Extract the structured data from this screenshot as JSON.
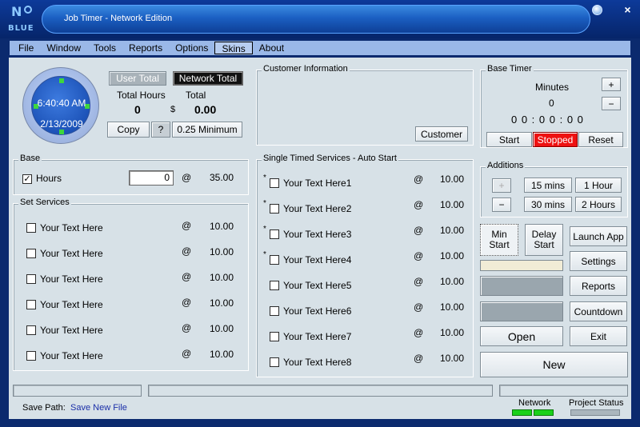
{
  "window": {
    "title": "Job Timer - Network Edition",
    "logo_letter": "N",
    "logo_text": "BLUE",
    "close_glyph": "×"
  },
  "menu": [
    "File",
    "Window",
    "Tools",
    "Reports",
    "Options",
    "Skins",
    "About"
  ],
  "menu_active": "Skins",
  "clock": {
    "time": "6:40:40 AM",
    "date": "2/13/2009"
  },
  "totals": {
    "user_total_label": "User Total",
    "network_total_label": "Network Total",
    "total_hours_label": "Total Hours",
    "total_label": "Total",
    "hours_value": "0",
    "currency": "$",
    "amount": "0.00",
    "copy_label": "Copy",
    "help_label": "?",
    "minimum_label": "0.25 Minimum"
  },
  "customer": {
    "group_label": "Customer Information",
    "button": "Customer"
  },
  "base_timer": {
    "group_label": "Base Timer",
    "minutes_label": "Minutes",
    "minutes_value": "0",
    "plus": "+",
    "minus": "−",
    "display": "0 0 : 0 0 : 0 0",
    "start": "Start",
    "stopped": "Stopped",
    "reset": "Reset"
  },
  "additions": {
    "group_label": "Additions",
    "plus": "+",
    "minus": "−",
    "buttons": [
      "15 mins",
      "1 Hour",
      "30 mins",
      "2 Hours"
    ]
  },
  "base": {
    "group_label": "Base",
    "label": "Hours",
    "checked": "✓",
    "input_value": "0",
    "at": "@",
    "rate": "35.00"
  },
  "set_services": {
    "group_label": "Set Services",
    "at": "@",
    "items": [
      {
        "label": "Your Text Here",
        "rate": "10.00"
      },
      {
        "label": "Your Text Here",
        "rate": "10.00"
      },
      {
        "label": "Your Text Here",
        "rate": "10.00"
      },
      {
        "label": "Your Text Here",
        "rate": "10.00"
      },
      {
        "label": "Your Text Here",
        "rate": "10.00"
      },
      {
        "label": "Your Text Here",
        "rate": "10.00"
      }
    ]
  },
  "timed_services": {
    "group_label": "Single Timed Services - Auto Start",
    "at": "@",
    "star": "*",
    "items": [
      {
        "label": "Your Text Here1",
        "rate": "10.00"
      },
      {
        "label": "Your Text Here2",
        "rate": "10.00"
      },
      {
        "label": "Your Text Here3",
        "rate": "10.00"
      },
      {
        "label": "Your Text Here4",
        "rate": "10.00"
      },
      {
        "label": "Your Text Here5",
        "rate": "10.00"
      },
      {
        "label": "Your Text Here6",
        "rate": "10.00"
      },
      {
        "label": "Your Text Here7",
        "rate": "10.00"
      },
      {
        "label": "Your Text Here8",
        "rate": "10.00"
      }
    ]
  },
  "side_buttons": {
    "min_start": "Min\nStart",
    "delay_start": "Delay\nStart",
    "launch_app": "Launch App",
    "settings": "Settings",
    "reports": "Reports",
    "countdown": "Countdown",
    "open": "Open",
    "exit": "Exit",
    "new": "New"
  },
  "status": {
    "save_path_label": "Save Path:",
    "save_path_value": "Save New File",
    "network_label": "Network",
    "project_status_label": "Project Status"
  }
}
